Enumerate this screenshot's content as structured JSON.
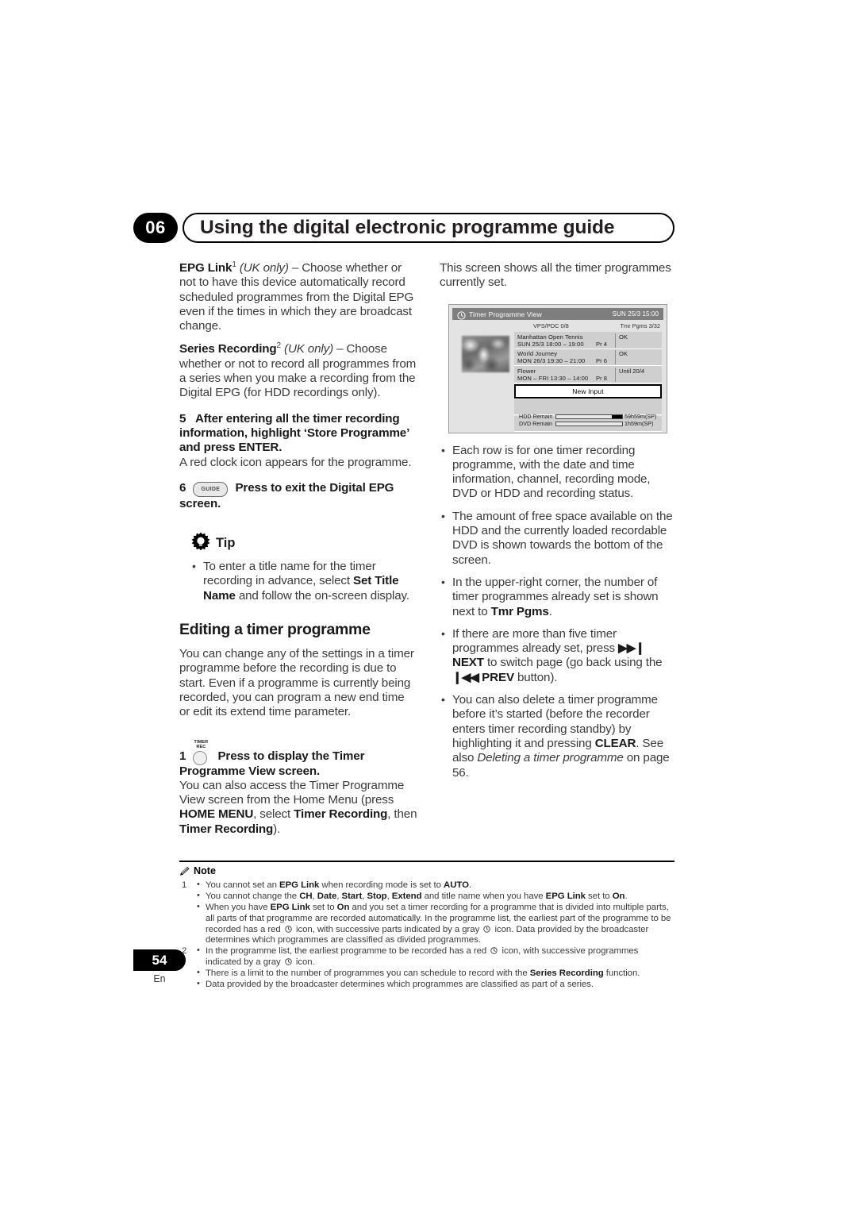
{
  "header": {
    "chapter_number": "06",
    "chapter_title": "Using the digital electronic programme guide"
  },
  "left_column": {
    "epg_link": {
      "term": "EPG Link",
      "footnote": "1",
      "qualifier": "(UK only)",
      "body": "– Choose whether or not to have this device automatically record scheduled programmes from the Digital EPG even if the times in which they are broadcast change."
    },
    "series_recording": {
      "term": "Series Recording",
      "footnote": "2",
      "qualifier": "(UK only)",
      "body": "– Choose whether or not to record all programmes from a series when you make a recording from the Digital EPG (for HDD recordings only)."
    },
    "step5": {
      "number": "5",
      "heading": "After entering all the timer recording information, highlight ‘Store Programme’ and press ENTER.",
      "body": "A red clock icon appears for the programme."
    },
    "step6": {
      "number": "6",
      "button_label": "GUIDE",
      "heading": "Press to exit the Digital EPG screen."
    },
    "tip": {
      "label": "Tip",
      "bullets": [
        {
          "pre": "To enter a title name for the timer recording in advance, select ",
          "bold": "Set Title Name",
          "post": " and follow the on-screen display."
        }
      ]
    },
    "section_heading": "Editing a timer programme",
    "section_body": "You can change any of the settings in a timer programme before the recording is due to start. Even if a programme is  currently being recorded, you can program a new end time or edit its extend time parameter.",
    "step1": {
      "number": "1",
      "button_label_line1": "TIMER",
      "button_label_line2": "REC",
      "heading": "Press to display the Timer Programme View screen.",
      "body_pre": "You can also access the Timer Programme View screen from the Home Menu (press ",
      "body_b1": "HOME MENU",
      "body_mid1": ", select ",
      "body_b2": "Timer Recording",
      "body_mid2": ", then ",
      "body_b3": "Timer Recording",
      "body_post": ")."
    }
  },
  "right_column": {
    "intro": "This screen shows all the timer programmes currently set.",
    "bullets": [
      {
        "text": "Each row is for one timer recording programme, with the date and time information, channel, recording mode, DVD or HDD and recording status."
      },
      {
        "text": "The amount of free space available on the HDD and the currently loaded recordable DVD is shown towards the bottom of the screen."
      },
      {
        "pre": "In the upper-right corner, the number of timer programmes already set is shown next to ",
        "bold": "Tmr Pgms",
        "post": "."
      },
      {
        "pre": "If there are more than five timer programmes already set, press ",
        "nav_next_icon": "▶▶❙",
        "bold": "NEXT",
        "mid": " to switch page (go back using the ",
        "nav_prev_icon": "❙◀◀",
        "bold2": "PREV",
        "post": " button)."
      },
      {
        "pre": "You can also delete a timer programme before it’s started (before the recorder enters timer recording standby) by highlighting it and pressing ",
        "bold": "CLEAR",
        "mid": ". See also ",
        "italic": "Deleting a timer programme",
        "post": " on page 56."
      }
    ]
  },
  "tv_screen": {
    "title": "Timer Programme View",
    "title_right": "SUN 25/3  15:00",
    "vps_pdc": "VPS/PDC 0/8",
    "tmr_pgms": "Tmr Pgms  3/32",
    "rows": [
      {
        "title": "Manhattan Open Tennis",
        "date": "SUN 25/3    18:00 – 19:00",
        "channel": "Pr 4",
        "status": "OK"
      },
      {
        "title": "World Journey",
        "date": "MON 26/3    19:30 – 21:00",
        "channel": "Pr 6",
        "status": "OK"
      },
      {
        "title": "Flower",
        "date": "MON – FRI  13:30 – 14:00",
        "channel": "Pr 8",
        "status": "Until 20/4"
      }
    ],
    "new_input_label": "New Input",
    "meters": [
      {
        "label": "HDD Remain",
        "value": "59h59m(SP)",
        "fill_pct": 16
      },
      {
        "label": "DVD Remain",
        "value": "1h59m(SP)",
        "fill_pct": 0
      }
    ]
  },
  "notes": {
    "label": "Note",
    "groups": [
      {
        "number": "1",
        "items": [
          {
            "segments": [
              {
                "t": "You cannot set an "
              },
              {
                "t": "EPG Link",
                "b": true
              },
              {
                "t": " when recording mode is set to "
              },
              {
                "t": "AUTO",
                "b": true
              },
              {
                "t": "."
              }
            ]
          },
          {
            "segments": [
              {
                "t": "You cannot change the "
              },
              {
                "t": "CH",
                "b": true
              },
              {
                "t": ", "
              },
              {
                "t": "Date",
                "b": true
              },
              {
                "t": ", "
              },
              {
                "t": "Start",
                "b": true
              },
              {
                "t": ", "
              },
              {
                "t": "Stop",
                "b": true
              },
              {
                "t": ", "
              },
              {
                "t": "Extend",
                "b": true
              },
              {
                "t": " and title name when you have "
              },
              {
                "t": "EPG Link",
                "b": true
              },
              {
                "t": " set to "
              },
              {
                "t": "On",
                "b": true
              },
              {
                "t": "."
              }
            ]
          },
          {
            "segments": [
              {
                "t": "When you have "
              },
              {
                "t": "EPG Link",
                "b": true
              },
              {
                "t": " set to "
              },
              {
                "t": "On",
                "b": true
              },
              {
                "t": " and you set a timer recording for a programme that is divided into multiple parts, all parts of that programme are recorded automatically. In the programme list, the earliest part of the programme to be recorded has a red "
              },
              {
                "clock": true
              },
              {
                "t": " icon, with successive parts indicated by a gray "
              },
              {
                "clock": true
              },
              {
                "t": " icon. Data provided by the broadcaster determines which programmes are classified as divided programmes."
              }
            ]
          }
        ]
      },
      {
        "number": "2",
        "items": [
          {
            "segments": [
              {
                "t": "In the programme list, the earliest programme to be recorded has a red "
              },
              {
                "clock": true
              },
              {
                "t": " icon, with successive programmes indicated by a gray "
              },
              {
                "clock": true
              },
              {
                "t": " icon."
              }
            ]
          },
          {
            "segments": [
              {
                "t": "There is a limit to the number of programmes you can schedule to record with the "
              },
              {
                "t": "Series Recording",
                "b": true
              },
              {
                "t": " function."
              }
            ]
          },
          {
            "segments": [
              {
                "t": "Data provided by the broadcaster determines which programmes are classified as part of a series."
              }
            ]
          }
        ]
      }
    ]
  },
  "footer": {
    "page_number": "54",
    "language": "En"
  }
}
